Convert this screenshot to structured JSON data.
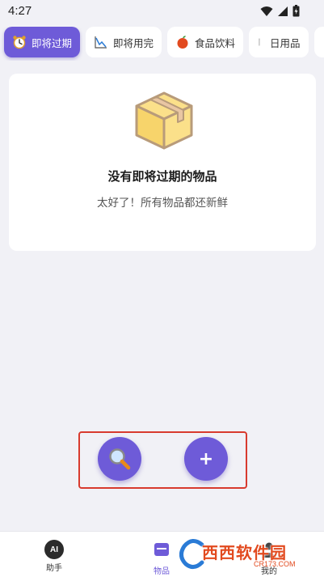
{
  "status_bar": {
    "time": "4:27"
  },
  "tabs": [
    {
      "label": "即将过期",
      "icon": "alarm-clock-icon",
      "active": true
    },
    {
      "label": "即将用完",
      "icon": "declining-chart-icon",
      "active": false
    },
    {
      "label": "食品饮料",
      "icon": "apple-icon",
      "active": false
    },
    {
      "label": "日用品",
      "icon": "toothbrush-icon",
      "active": false
    },
    {
      "label": "",
      "icon": "phone-icon",
      "active": false
    }
  ],
  "empty_state": {
    "icon": "box-icon",
    "title": "没有即将过期的物品",
    "subtitle": "太好了！所有物品都还新鲜"
  },
  "fab": {
    "search_icon": "magnifier-icon",
    "add_label": "+"
  },
  "bottom_nav": {
    "items": [
      {
        "label": "助手",
        "icon": "ai-icon",
        "badge": "AI"
      },
      {
        "label": "物品",
        "icon": "items-icon",
        "active": true
      },
      {
        "label": "我的",
        "icon": "profile-icon"
      }
    ]
  },
  "watermark": {
    "text": "西西软件园",
    "sub": "CR173.COM"
  },
  "colors": {
    "accent": "#6e5bd8",
    "background": "#f1f1f6",
    "highlight_frame": "#d83a2e"
  }
}
